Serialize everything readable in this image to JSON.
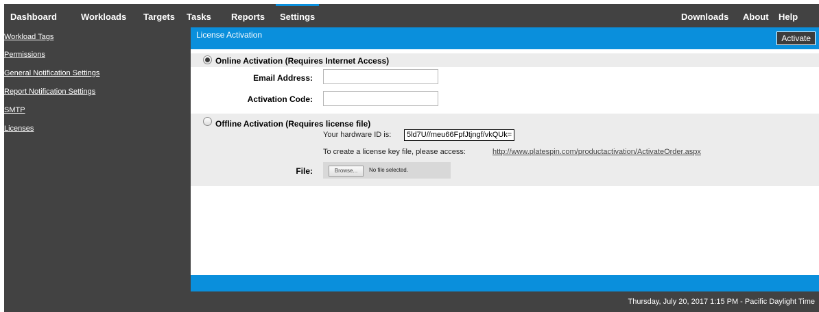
{
  "nav": {
    "left": [
      "Dashboard",
      "Workloads",
      "Targets",
      "Tasks",
      "Reports",
      "Settings"
    ],
    "active": "Settings",
    "right": [
      "Downloads",
      "About",
      "Help"
    ]
  },
  "sidebar": {
    "items": [
      "Workload Tags",
      "Permissions",
      "General Notification Settings",
      "Report Notification Settings",
      "SMTP",
      "Licenses"
    ]
  },
  "panel": {
    "title": "License Activation",
    "activate_label": "Activate",
    "online": {
      "label": "Online Activation (Requires Internet Access)",
      "selected": true,
      "email_label": "Email Address:",
      "email_value": "",
      "code_label": "Activation Code:",
      "code_value": ""
    },
    "offline": {
      "label": "Offline Activation (Requires license file)",
      "selected": false,
      "hwid_label": "Your hardware ID is:",
      "hwid_value": "5ld7U//meu66FpfJtjngf/vkQUk=",
      "create_text": "To create a license key file, please access:",
      "link": "http://www.platespin.com/productactivation/ActivateOrder.aspx",
      "file_label": "File:",
      "browse_label": "Browse...",
      "file_status": "No file selected."
    }
  },
  "status": {
    "datetime": "Thursday, July 20, 2017 1:15 PM - Pacific Daylight Time"
  },
  "colors": {
    "chrome": "#424242",
    "accent": "#0a8fdc",
    "section_bg": "#ececec"
  }
}
